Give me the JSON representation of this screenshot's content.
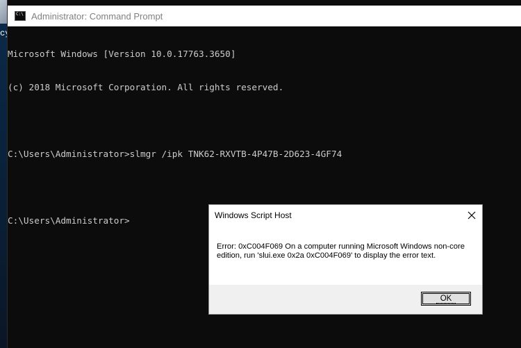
{
  "window": {
    "title": "Administrator: Command Prompt",
    "icon": "cmd-icon"
  },
  "desktop": {
    "label_fragment": "cy"
  },
  "console": {
    "lines": [
      "Microsoft Windows [Version 10.0.17763.3650]",
      "(c) 2018 Microsoft Corporation. All rights reserved.",
      "",
      "C:\\Users\\Administrator>slmgr /ipk TNK62-RXVTB-4P47B-2D623-4GF74",
      "",
      "C:\\Users\\Administrator>"
    ]
  },
  "dialog": {
    "title": "Windows Script Host",
    "message": "Error: 0xC004F069 On a computer running Microsoft Windows non-core edition, run 'slui.exe 0x2a 0xC004F069' to display the error text.",
    "ok_label": "OK"
  },
  "colors": {
    "console_bg": "#0c0c0c",
    "console_fg": "#cccccc",
    "titlebar_bg": "#ffffff",
    "dialog_footer": "#f0f0f0"
  }
}
